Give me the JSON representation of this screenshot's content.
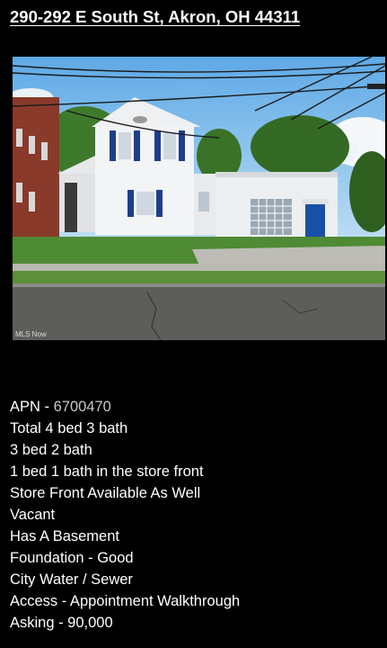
{
  "title": "290-292 E South St, Akron, OH 44311",
  "photo": {
    "watermark": "MLS Now",
    "colors": {
      "sky": "#8fc3ec",
      "siding": "#f2f4f6",
      "trim_blue": "#1d3f8a",
      "door_blue": "#1a4fa8",
      "brick": "#8a3a2a",
      "grass": "#4f8a34",
      "road": "#5d5d5b"
    }
  },
  "details": {
    "apn_label": "APN - ",
    "apn_value": "6700470",
    "lines": [
      "Total 4 bed 3 bath",
      "3 bed 2 bath",
      "1 bed 1 bath in the store front",
      "Store Front Available As Well",
      "Vacant",
      "Has A Basement",
      "Foundation - Good",
      "City Water / Sewer",
      "Access - Appointment Walkthrough",
      "Asking - 90,000"
    ]
  }
}
